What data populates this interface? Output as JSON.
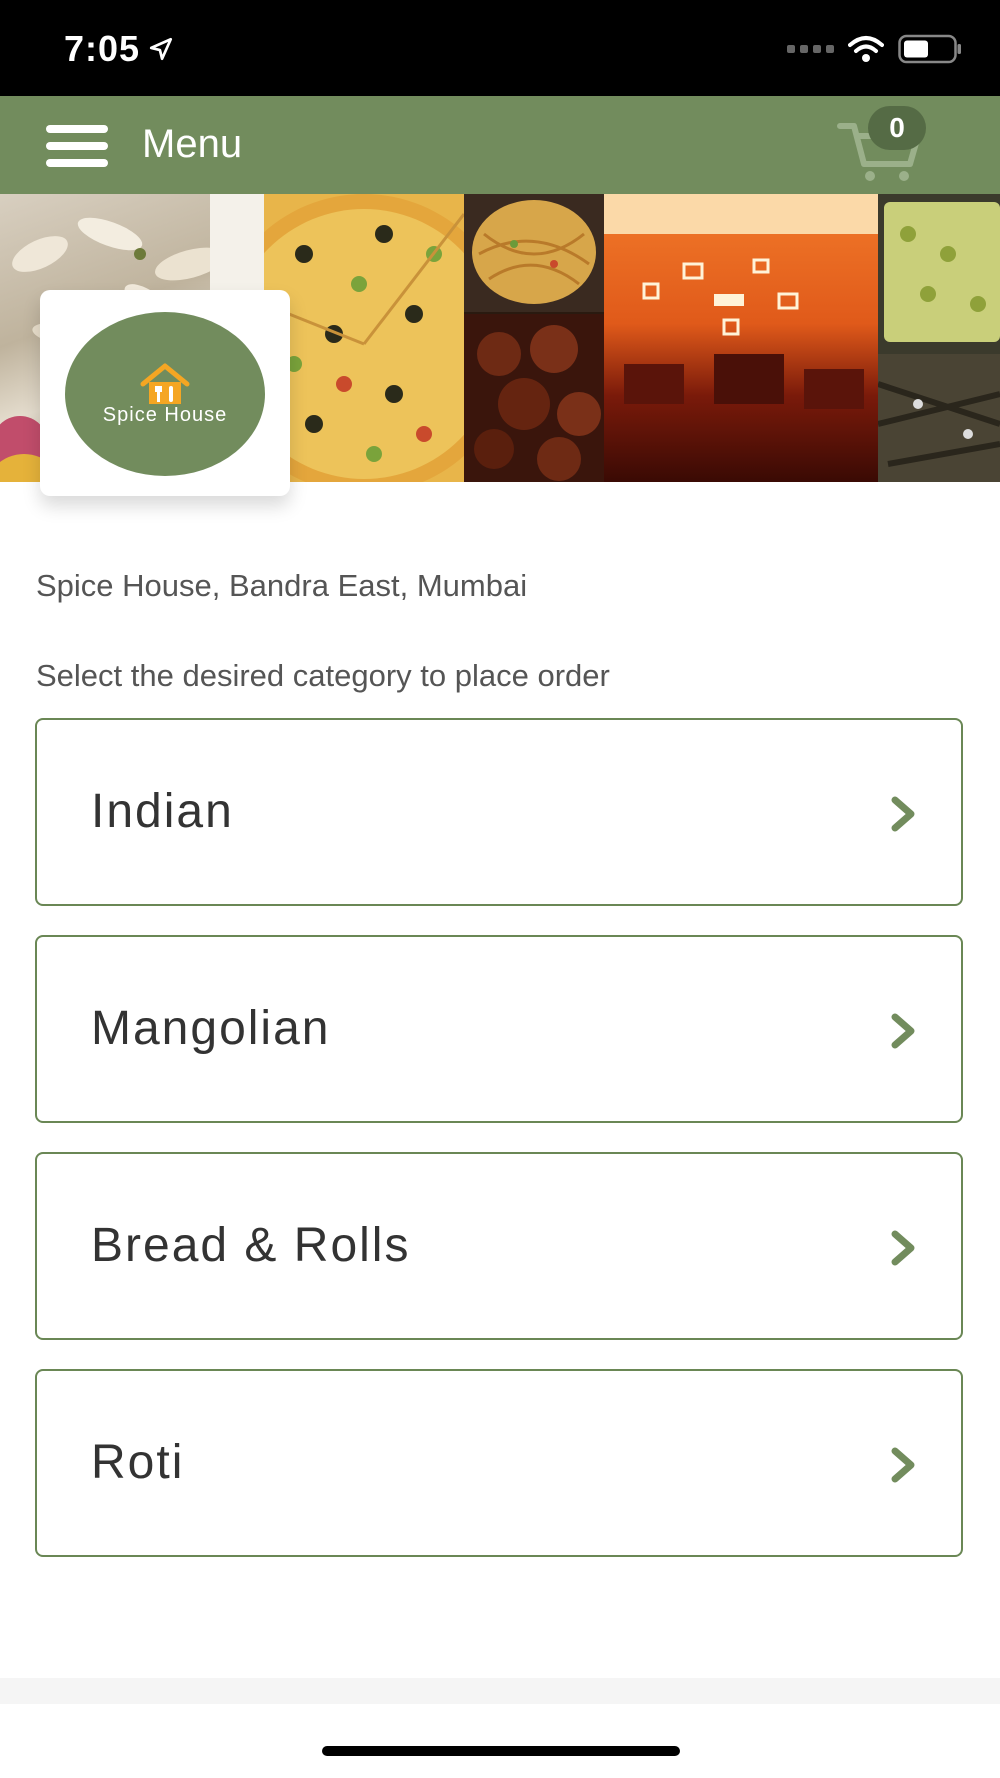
{
  "status_bar": {
    "time": "7:05",
    "icons": [
      "location-arrow-icon",
      "signal-icon",
      "wifi-icon",
      "battery-icon"
    ]
  },
  "header": {
    "title": "Menu",
    "menu_icon": "hamburger-icon",
    "cart_icon": "cart-icon",
    "cart_count": "0"
  },
  "restaurant": {
    "logo_text": "Spice House",
    "address": "Spice House, Bandra East, Mumbai"
  },
  "instruction": "Select the desired category to place order",
  "categories": [
    {
      "label": "Indian"
    },
    {
      "label": "Mangolian"
    },
    {
      "label": "Bread & Rolls"
    },
    {
      "label": "Roti"
    }
  ],
  "colors": {
    "brand_green": "#728c5d",
    "badge_green": "#556b45",
    "border_green": "#6a8755",
    "text_gray": "#555555"
  }
}
